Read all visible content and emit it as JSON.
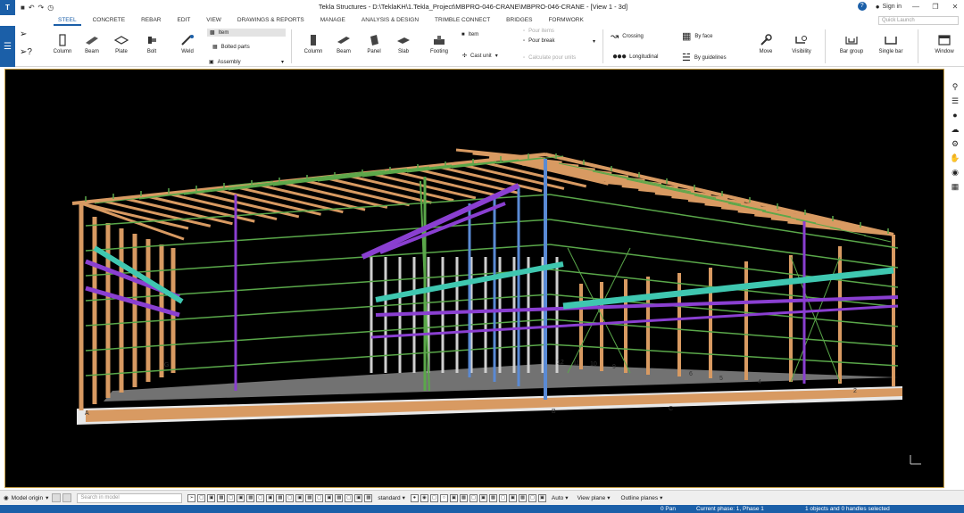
{
  "app": {
    "window_title": "Tekla Structures - D:\\TeklaKH\\1.Tekla_Project\\MBPRO-046-CRANE\\MBPRO-046-CRANE - [View 1 - 3d]",
    "sign_in": "Sign in"
  },
  "menu": {
    "tabs": [
      "STEEL",
      "CONCRETE",
      "REBAR",
      "EDIT",
      "VIEW",
      "DRAWINGS & REPORTS",
      "MANAGE",
      "ANALYSIS & DESIGN",
      "TRIMBLE CONNECT",
      "BRIDGES",
      "FORMWORK"
    ],
    "active": "STEEL",
    "quick_launch_placeholder": "Quick Launch"
  },
  "ribbon": {
    "steel_column": "Column",
    "steel_beam": "Beam",
    "steel_plate": "Plate",
    "steel_bolt": "Bolt",
    "steel_weld": "Weld",
    "item": "Item",
    "bolted_parts": "Bolted parts",
    "assembly": "Assembly",
    "conc_column": "Column",
    "conc_beam": "Beam",
    "conc_panel": "Panel",
    "conc_slab": "Slab",
    "conc_footing": "Footing",
    "conc_item": "Item",
    "cast_unit": "Cast unit",
    "pour_break": "Pour break",
    "pour_items": "Pour items",
    "calculate_pour_units": "Calculate pour units",
    "crossing": "Crossing",
    "longitudinal": "Longitudinal",
    "by_face": "By face",
    "by_guidelines": "By guidelines",
    "move": "Move",
    "visibility": "Visibility",
    "bar_group": "Bar group",
    "single_bar": "Single bar",
    "window": "Window"
  },
  "viewport": {
    "grid_labels": [
      "A",
      "B",
      "C",
      "G",
      "1",
      "2",
      "4",
      "5",
      "6",
      "9",
      "10",
      "11",
      "12"
    ]
  },
  "statusbar": {
    "model_origin": "Model origin",
    "search_placeholder": "Search in model",
    "standard": "standard",
    "auto": "Auto",
    "view_plane": "View plane",
    "outline_planes": "Outline planes"
  },
  "bottom": {
    "pan": "0  Pan",
    "phase": "Current phase: 1, Phase 1",
    "selection": "1 objects and 0 handles selected"
  },
  "colors": {
    "brand": "#1b5fa8",
    "column_tan": "#d89a62",
    "bracing_green": "#5aa84a",
    "crane_purple": "#8a3fd1",
    "rail_teal": "#3fc7b0",
    "column_blue": "#5a8ad4"
  }
}
